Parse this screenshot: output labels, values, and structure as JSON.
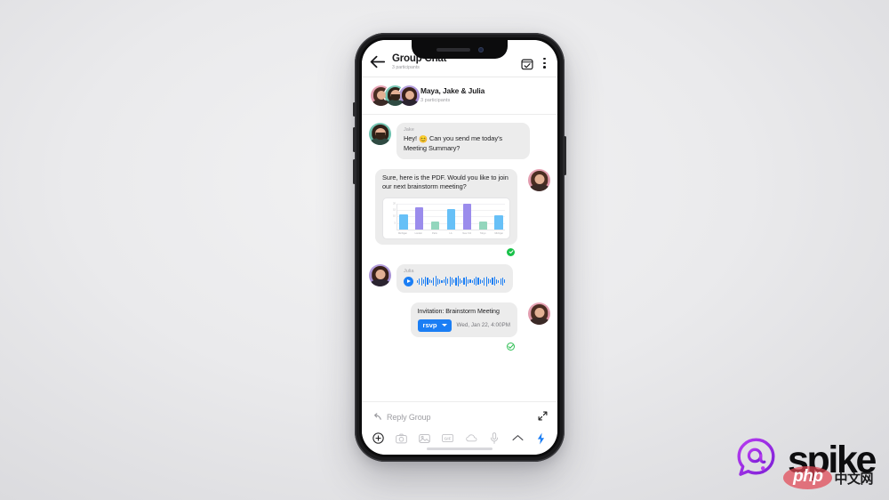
{
  "app": {
    "header": {
      "title": "Group Chat",
      "subtitle": "3 participants",
      "back_icon": "arrow-left-icon",
      "calendar_icon": "calendar-check-icon",
      "menu_icon": "kebab-menu-icon"
    },
    "participants": {
      "title": "Maya, Jake & Julia",
      "count": "3 participants",
      "avatars": [
        {
          "name": "Maya",
          "bg": "#e0a0b1"
        },
        {
          "name": "Jake",
          "bg": "#6ac0ac"
        },
        {
          "name": "Julia",
          "bg": "#ad95d6"
        }
      ]
    },
    "messages": [
      {
        "id": "msg-jake-request",
        "direction": "in",
        "sender": "Jake",
        "emoji": "😊",
        "text_before": "Hey!",
        "text_after": "Can you send me today’s Meeting Summary?"
      },
      {
        "id": "msg-maya-pdf",
        "direction": "out",
        "sender": "Maya",
        "text": "Sure, here is the PDF. Would you like to join our next brainstorm meeting?",
        "attachment": "bar-chart-pdf",
        "status": "sent",
        "status_icon": "check-filled-icon"
      },
      {
        "id": "msg-julia-voice",
        "direction": "in",
        "sender": "Julia",
        "type": "voice",
        "play_icon": "play-icon"
      },
      {
        "id": "msg-maya-invite",
        "direction": "out",
        "sender": "Maya",
        "type": "invitation",
        "title": "Invitation: Brainstorm Meeting",
        "rsvp_label": "rsvp",
        "rsvp_caret": "chevron-down-icon",
        "datetime": "Wed, Jan 22, 4:00PM",
        "status": "read",
        "status_icon": "check-circle-outline-icon"
      }
    ],
    "composer": {
      "reply_icon": "reply-arrow-icon",
      "placeholder": "Reply Group",
      "expand_icon": "expand-icon",
      "tools": [
        {
          "name": "add-icon",
          "label": "+"
        },
        {
          "name": "camera-icon",
          "label": "Camera"
        },
        {
          "name": "image-icon",
          "label": "Image"
        },
        {
          "name": "gif-icon",
          "label": "GIF"
        },
        {
          "name": "cloud-icon",
          "label": "Cloud"
        },
        {
          "name": "microphone-icon",
          "label": "Mic"
        },
        {
          "name": "chevron-up-icon",
          "label": "More"
        },
        {
          "name": "lightning-bolt-icon",
          "label": "Quick actions"
        }
      ]
    }
  },
  "brand": {
    "wordmark": "spike",
    "logo_icon": "spike-at-bubble-icon",
    "accent_purple": "#9b2ee8",
    "accent_blue": "#1b7ef4",
    "accent_green": "#18c149"
  },
  "watermark": {
    "php": "php",
    "cn": "中文网"
  },
  "chart_data": {
    "type": "bar",
    "title": "",
    "xlabel": "",
    "ylabel": "",
    "categories": [
      "Michigan",
      "London",
      "Paris",
      "LA",
      "New York",
      "Tokyo",
      "Michigan"
    ],
    "values": [
      12,
      17,
      6,
      16,
      20,
      6,
      11
    ],
    "ylim": [
      0,
      20
    ],
    "yticks": [
      "20",
      "15",
      "10",
      "5"
    ],
    "grid": true,
    "legend": "none",
    "colors": [
      "#67c0f7",
      "#9b8cec",
      "#93d6bd",
      "#67c0f7",
      "#9b8cec",
      "#93d6bd",
      "#67c0f7"
    ]
  }
}
